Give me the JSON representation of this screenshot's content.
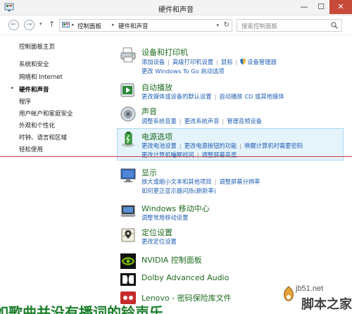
{
  "window": {
    "title": "硬件和声音",
    "minimize_label": "—",
    "maximize_label": "☐",
    "close_label": "✕"
  },
  "navigation": {
    "back_glyph": "←",
    "forward_glyph": "→",
    "recent_glyph": "▾",
    "up_glyph": "↑",
    "address_separator": "▸",
    "breadcrumb": [
      "控制面板",
      "硬件和声音"
    ],
    "address_dropdown_glyph": "▾",
    "refresh_glyph": "↻",
    "search_placeholder": "搜索控制面板"
  },
  "leftnav": {
    "home": "控制面板主页",
    "bullet": "•",
    "items": [
      {
        "label": "系统和安全",
        "active": false
      },
      {
        "label": "网络和 Internet",
        "active": false
      },
      {
        "label": "硬件和声音",
        "active": true
      },
      {
        "label": "程序",
        "active": false
      },
      {
        "label": "用户帐户和家庭安全",
        "active": false
      },
      {
        "label": "外观和个性化",
        "active": false
      },
      {
        "label": "时钟、语言和区域",
        "active": false
      },
      {
        "label": "轻松使用",
        "active": false
      }
    ]
  },
  "separator": "|",
  "categories": {
    "devices": {
      "heading": "设备和打印机",
      "row1": [
        "添加设备",
        "高级打印机设置",
        "鼠标",
        "设备管理器"
      ],
      "row2": [
        "更改 Windows To Go 启动选项"
      ]
    },
    "autoplay": {
      "heading": "自动播放",
      "row1": [
        "更改媒体或设备的默认设置",
        "自动播放 CD 或其他媒体"
      ]
    },
    "sound": {
      "heading": "声音",
      "row1": [
        "调整系统音量",
        "更改系统声音",
        "管理音频设备"
      ]
    },
    "power": {
      "heading": "电源选项",
      "row1": [
        "更改电池设置",
        "更改电源按钮的功能",
        "唤醒计算机时需要密码"
      ],
      "row2": [
        "更改计算机睡眠时间",
        "调整屏幕亮度"
      ]
    },
    "display": {
      "heading": "显示",
      "row1": [
        "放大或缩小文本和其他项目",
        "调整屏幕分辨率"
      ],
      "row2": [
        "如何更正显示器闪烁(刷新率)"
      ]
    },
    "mobility": {
      "heading": "Windows 移动中心",
      "row1": [
        "调整常用移动设置"
      ]
    },
    "location": {
      "heading": "定位设置",
      "row1": [
        "更改定位设置"
      ]
    },
    "nvidia": {
      "heading": "NVIDIA 控制面板"
    },
    "dolby": {
      "heading": "Dolby Advanced Audio"
    },
    "lenovo": {
      "heading": "Lenovo - 密码保险库文件"
    }
  },
  "overlay": {
    "caption": "如歌曲并没有播词的铃声乐",
    "watermark_site": "jb51.net",
    "watermark_name": "脚本之家"
  },
  "colors": {
    "heading_green": "#1e6b1e",
    "link_blue": "#1f5fb5",
    "highlight_bg": "#e5f3fb",
    "highlight_border": "#a9d8f2",
    "close_red": "#c7493a"
  }
}
